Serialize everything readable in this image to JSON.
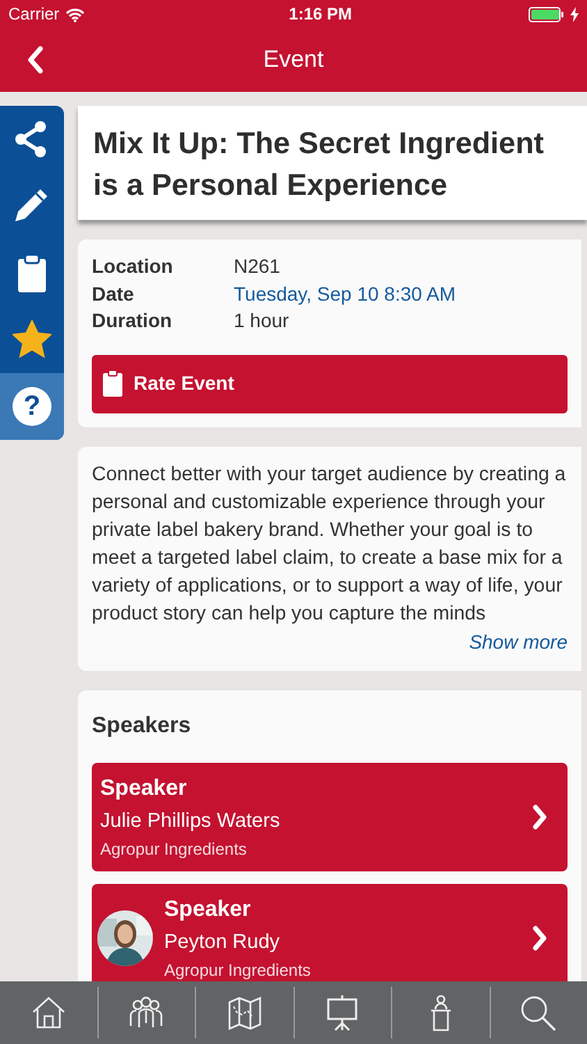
{
  "status_bar": {
    "carrier": "Carrier",
    "time": "1:16 PM",
    "charging": true
  },
  "nav": {
    "title": "Event"
  },
  "side_actions": [
    {
      "kind": "share",
      "selected": false
    },
    {
      "kind": "edit",
      "selected": false
    },
    {
      "kind": "notes",
      "selected": false
    },
    {
      "kind": "favorite",
      "selected": false,
      "on": true
    },
    {
      "kind": "help",
      "selected": true,
      "glyph": "?"
    }
  ],
  "event": {
    "title": "Mix It Up: The Secret Ingredient is a Personal Experience",
    "details": [
      {
        "label": "Location",
        "value": "N261",
        "kind": "text"
      },
      {
        "label": "Date",
        "value": "Tuesday, Sep 10 8:30 AM",
        "kind": "link"
      },
      {
        "label": "Duration",
        "value": "1 hour",
        "kind": "text"
      }
    ],
    "rate_button": "Rate Event",
    "description": "Connect better with your target audience by creating a personal and customizable experience through your private label bakery brand. Whether your goal is to meet a targeted label claim, to create a base mix for a variety of applications, or to support a way of life, your product story can help you capture the minds",
    "show_more": "Show more"
  },
  "speakers": {
    "heading": "Speakers",
    "items": [
      {
        "role": "Speaker",
        "name": "Julie Phillips Waters",
        "company": "Agropur Ingredients",
        "has_photo": false
      },
      {
        "role": "Speaker",
        "name": "Peyton Rudy",
        "company": "Agropur Ingredients",
        "has_photo": true
      }
    ]
  },
  "tab_bar": [
    {
      "kind": "home"
    },
    {
      "kind": "people"
    },
    {
      "kind": "map"
    },
    {
      "kind": "presentation"
    },
    {
      "kind": "podium"
    },
    {
      "kind": "search"
    }
  ]
}
